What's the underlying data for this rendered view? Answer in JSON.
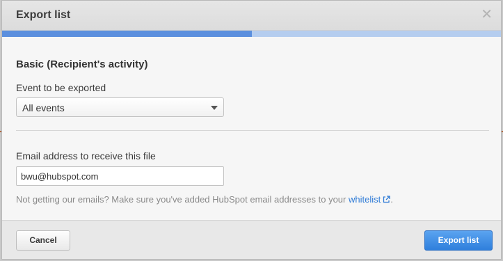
{
  "dialog": {
    "title": "Export list",
    "close_icon": "close-icon",
    "progress_fraction": 0.5
  },
  "form": {
    "section_heading": "Basic (Recipient's activity)",
    "event_label": "Event to be exported",
    "event_selected": "All events",
    "email_label": "Email address to receive this file",
    "email_value": "bwu@hubspot.com",
    "note_text": "Not getting our emails? Make sure you've added HubSpot email addresses to your ",
    "note_link": "whitelist",
    "note_end": "."
  },
  "footer": {
    "cancel_label": "Cancel",
    "export_label": "Export list"
  },
  "colors": {
    "progress_fill": "#5b8fde",
    "progress_track": "#b5cdef",
    "primary_button": "#3b8ae6",
    "link": "#2f7bd6"
  }
}
